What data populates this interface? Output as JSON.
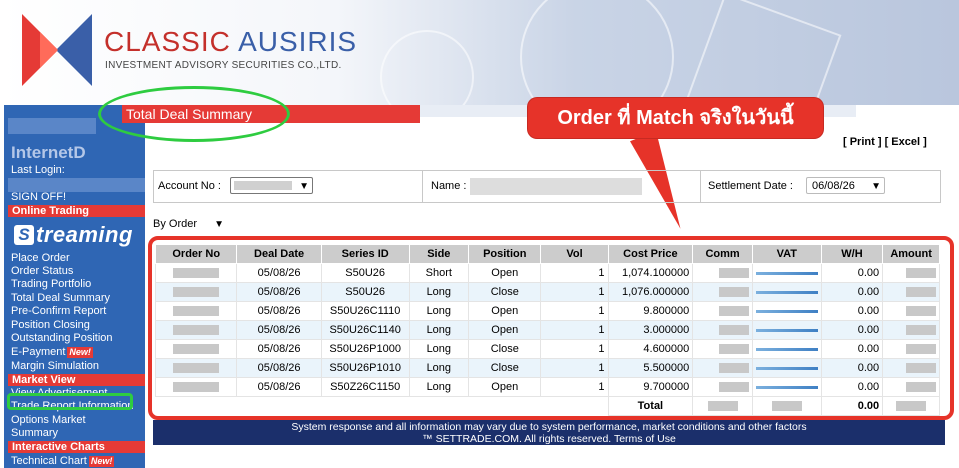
{
  "brand": {
    "name_part1": "CLASSIC",
    "name_part2": "AUSIRIS",
    "subtitle": "INVESTMENT ADVISORY SECURITIES CO.,LTD."
  },
  "sidebar": {
    "title": "InternetD",
    "last_login_label": "Last Login:",
    "sign_off": "SIGN OFF!",
    "sections": {
      "online_trading": "Online Trading",
      "market_view": "Market View",
      "interactive_charts": "Interactive Charts"
    },
    "streaming_logo": {
      "letter": "S",
      "word": "treaming"
    },
    "online_trading_items": [
      {
        "label": "Place Order"
      },
      {
        "label": "Order Status"
      },
      {
        "label": "Trading Portfolio"
      },
      {
        "label": "Total Deal Summary"
      },
      {
        "label": "Pre-Confirm Report"
      },
      {
        "label": "Position Closing"
      },
      {
        "label": "Outstanding Position"
      },
      {
        "label": "E-Payment",
        "badge": "New!"
      },
      {
        "label": "Margin Simulation"
      }
    ],
    "market_view_items": [
      {
        "label": "View Advertisement"
      },
      {
        "label": "Trade Report Information"
      },
      {
        "label": "Options Market"
      },
      {
        "label": "Summary"
      }
    ],
    "chart_items": [
      {
        "label": "Technical Chart",
        "badge": "New!"
      }
    ]
  },
  "page": {
    "title": "Total Deal Summary",
    "print": "[ Print ]",
    "excel": "[ Excel ]"
  },
  "callout": {
    "text": "Order ที่ Match จริงในวันนี้"
  },
  "form": {
    "account_label": "Account No :",
    "name_label": "Name :",
    "settlement_label": "Settlement Date :",
    "settlement_value": "06/08/26",
    "group_by": "By Order"
  },
  "table": {
    "headers": [
      "Order No",
      "Deal Date",
      "Series ID",
      "Side",
      "Position",
      "Vol",
      "Cost Price",
      "Comm",
      "VAT",
      "W/H",
      "Amount"
    ],
    "rows": [
      {
        "deal_date": "05/08/26",
        "series": "S50U26",
        "side": "Short",
        "position": "Open",
        "vol": "1",
        "cost": "1,074.100000",
        "wh": "0.00"
      },
      {
        "deal_date": "05/08/26",
        "series": "S50U26",
        "side": "Long",
        "position": "Close",
        "vol": "1",
        "cost": "1,076.000000",
        "wh": "0.00"
      },
      {
        "deal_date": "05/08/26",
        "series": "S50U26C1110",
        "side": "Long",
        "position": "Open",
        "vol": "1",
        "cost": "9.800000",
        "wh": "0.00"
      },
      {
        "deal_date": "05/08/26",
        "series": "S50U26C1140",
        "side": "Long",
        "position": "Open",
        "vol": "1",
        "cost": "3.000000",
        "wh": "0.00"
      },
      {
        "deal_date": "05/08/26",
        "series": "S50U26P1000",
        "side": "Long",
        "position": "Close",
        "vol": "1",
        "cost": "4.600000",
        "wh": "0.00"
      },
      {
        "deal_date": "05/08/26",
        "series": "S50U26P1010",
        "side": "Long",
        "position": "Close",
        "vol": "1",
        "cost": "5.500000",
        "wh": "0.00"
      },
      {
        "deal_date": "05/08/26",
        "series": "S50Z26C1150",
        "side": "Long",
        "position": "Open",
        "vol": "1",
        "cost": "9.700000",
        "wh": "0.00"
      }
    ],
    "total_label": "Total",
    "total_wh": "0.00"
  },
  "footer": {
    "line1": "System response and all information may vary due to system performance, market conditions and other factors",
    "line2": "™ SETTRADE.COM. All rights reserved. Terms of Use"
  },
  "colors": {
    "accent_red": "#e53a36",
    "sidebar_blue": "#2f66b4",
    "footer_navy": "#1b2f6b",
    "highlight_green": "#2ecc40"
  }
}
